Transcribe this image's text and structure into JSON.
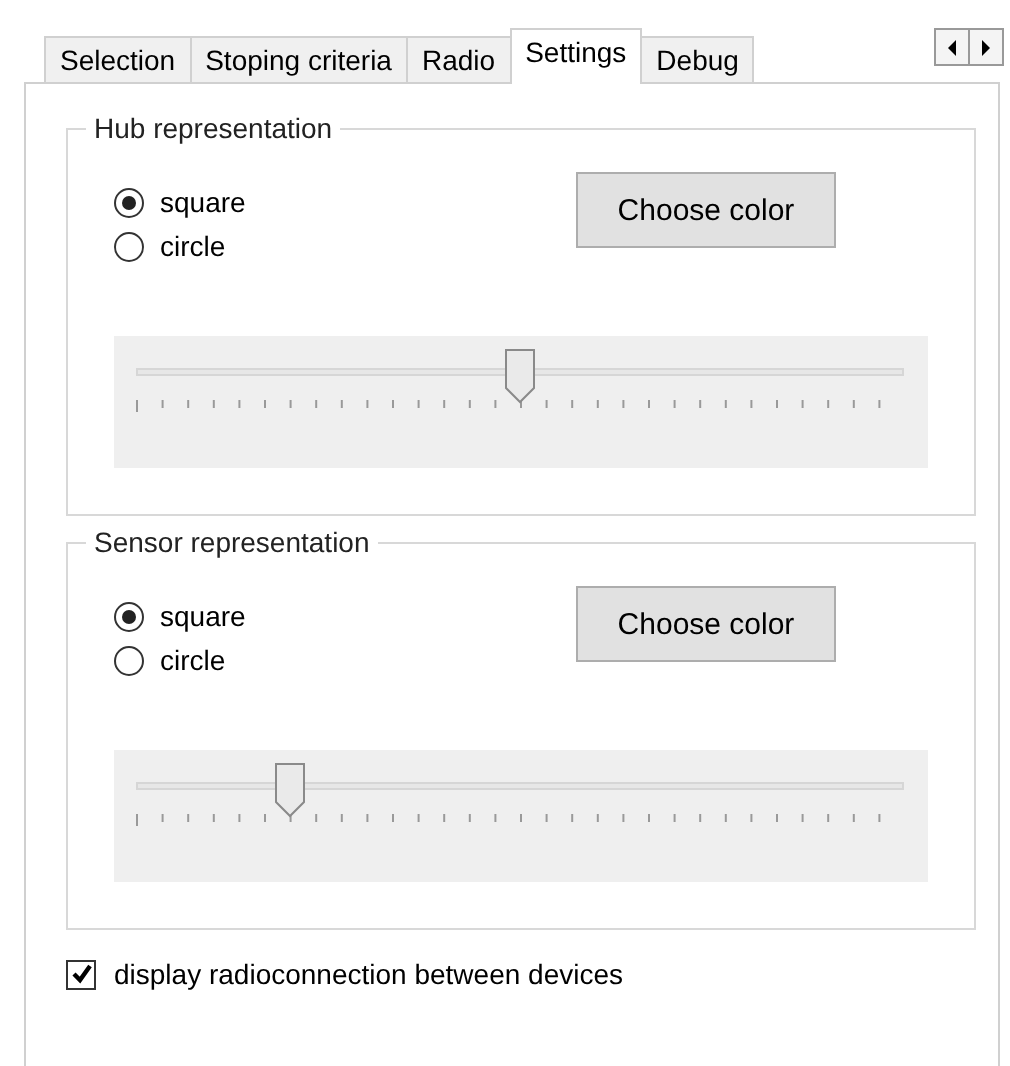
{
  "tabs": [
    {
      "label": "Selection",
      "selected": false
    },
    {
      "label": "Stoping criteria",
      "selected": false
    },
    {
      "label": "Radio",
      "selected": false
    },
    {
      "label": "Settings",
      "selected": true
    },
    {
      "label": "Debug",
      "selected": false
    }
  ],
  "groups": [
    {
      "title": "Hub representation",
      "options": [
        {
          "label": "square",
          "selected": true
        },
        {
          "label": "circle",
          "selected": false
        }
      ],
      "button": "Choose color",
      "slider": {
        "level": 0.5
      }
    },
    {
      "title": "Sensor representation",
      "options": [
        {
          "label": "square",
          "selected": true
        },
        {
          "label": "circle",
          "selected": false
        }
      ],
      "button": "Choose color",
      "slider": {
        "level": 0.2
      }
    }
  ],
  "checkbox": {
    "label": "display radioconnection between devices",
    "checked": true
  }
}
